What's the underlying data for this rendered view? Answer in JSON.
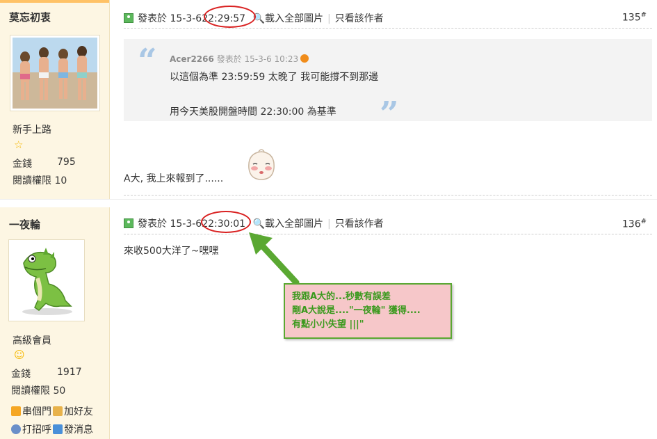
{
  "users": [
    {
      "name": "莫忘初衷",
      "rank": "新手上路",
      "money_label": "金錢",
      "money": "795",
      "perm_label": "閱讀權限",
      "perm": "10"
    },
    {
      "name": "一夜輪",
      "rank": "高級會員",
      "money_label": "金錢",
      "money": "1917",
      "perm_label": "閱讀權限",
      "perm": "50",
      "actions": [
        "串個門",
        "加好友",
        "打招呼",
        "發消息"
      ]
    }
  ],
  "posts": [
    {
      "posted_label": "發表於",
      "date": "15-3-6",
      "time": "22:29:57",
      "load_images": "載入全部圖片",
      "author_only": "只看該作者",
      "floor": "135",
      "quote": {
        "user": "Acer2266",
        "posted_label": "發表於",
        "datetime": "15-3-6 10:23",
        "line1": "以這個為準 23:59:59 太晚了 我可能撐不到那邊",
        "line2": "用今天美股開盤時間 22:30:00 為基準"
      },
      "body": "A大, 我上來報到了......"
    },
    {
      "posted_label": "發表於",
      "date": "15-3-6",
      "time": "22:30:01",
      "load_images": "載入全部圖片",
      "author_only": "只看該作者",
      "floor": "136",
      "body": "來收500大洋了~嘿嘿"
    }
  ],
  "callout": {
    "line1": "我跟A大的...秒數有誤差",
    "line2": "剛A大說是....\"一夜輪\" 獲得....",
    "line3": "有點小小失望 |||\""
  },
  "floor_mark": "#",
  "colors": {
    "sidebar_bg": "#fdf6e3",
    "accent_bar": "#ffc266",
    "ring": "#d92020",
    "callout_bg": "#f6c7c9",
    "callout_text": "#3b9a1e",
    "arrow": "#5aa832"
  }
}
